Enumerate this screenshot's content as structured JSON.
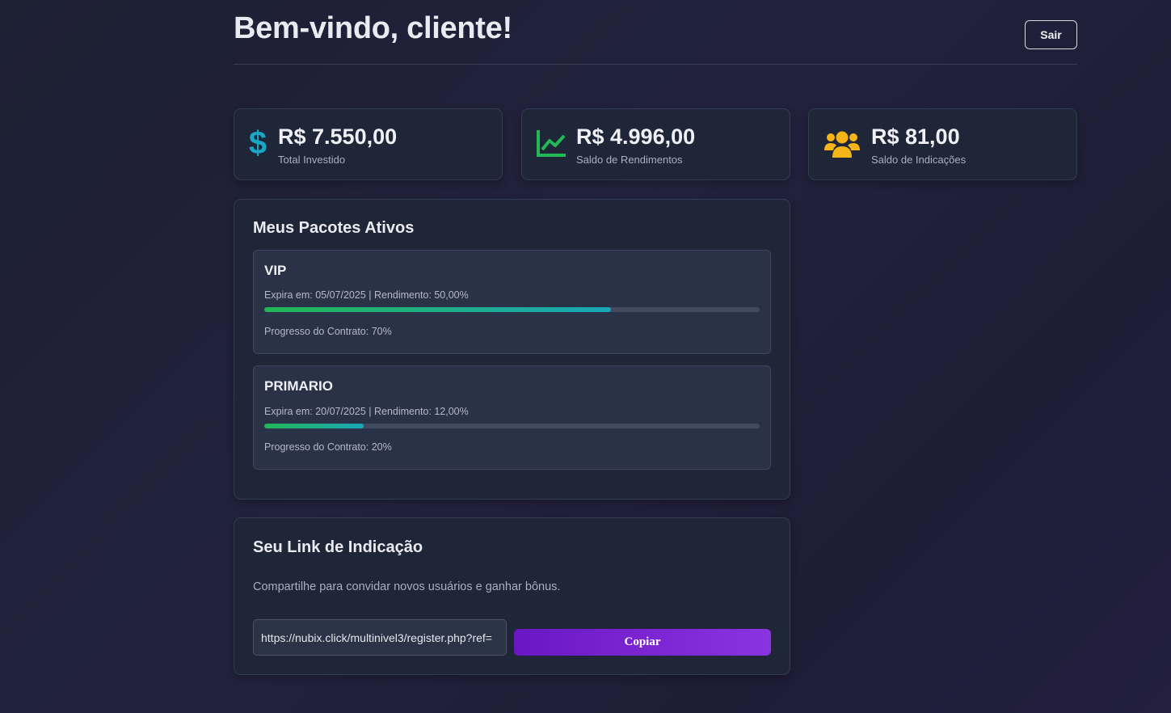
{
  "header": {
    "title": "Bem-vindo, cliente!",
    "logout_label": "Sair"
  },
  "stats": [
    {
      "icon": "dollar-icon",
      "value": "R$ 7.550,00",
      "label": "Total Investido",
      "color": "#1ba6c4"
    },
    {
      "icon": "chart-line-icon",
      "value": "R$ 4.996,00",
      "label": "Saldo de Rendimentos",
      "color": "#22b856"
    },
    {
      "icon": "users-icon",
      "value": "R$ 81,00",
      "label": "Saldo de Indicações",
      "color": "#f5b417"
    }
  ],
  "packages": {
    "title": "Meus Pacotes Ativos",
    "items": [
      {
        "name": "VIP",
        "info": "Expira em: 05/07/2025 | Rendimento: 50,00%",
        "progress": 70,
        "progress_text": "Progresso do Contrato: 70%"
      },
      {
        "name": "PRIMARIO",
        "info": "Expira em: 20/07/2025 | Rendimento: 12,00%",
        "progress": 20,
        "progress_text": "Progresso do Contrato: 20%"
      }
    ]
  },
  "referral": {
    "title": "Seu Link de Indicação",
    "description": "Compartilhe para convidar novos usuários e ganhar bônus.",
    "link": "https://nubix.click/multinivel3/register.php?ref=",
    "copy_label": "Copiar"
  },
  "colors": {
    "accent_purple": "#7a24d4",
    "progress_start": "#22b856",
    "progress_end": "#1aa6b7"
  }
}
